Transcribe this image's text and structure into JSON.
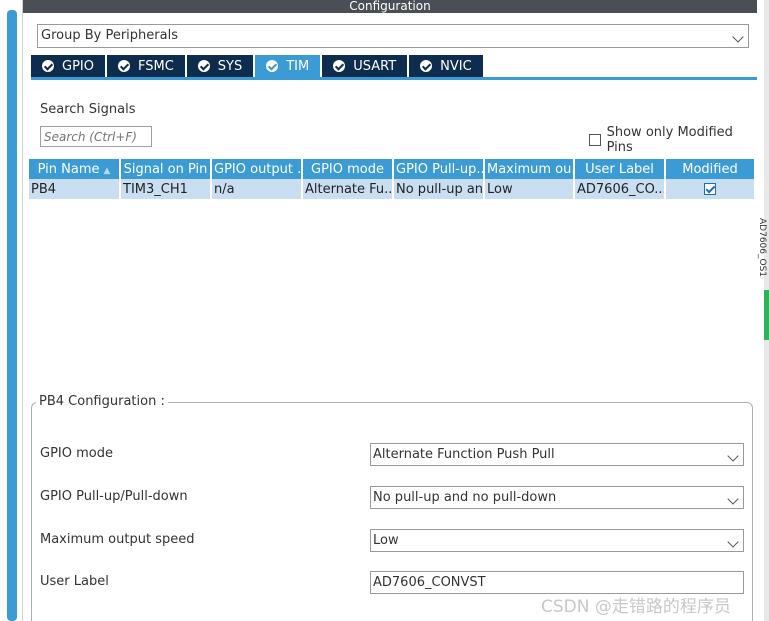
{
  "header": {
    "title": "Configuration"
  },
  "group_select": {
    "value": "Group By Peripherals"
  },
  "tabs": [
    {
      "label": "GPIO",
      "active": false
    },
    {
      "label": "FSMC",
      "active": false
    },
    {
      "label": "SYS",
      "active": false
    },
    {
      "label": "TIM",
      "active": true
    },
    {
      "label": "USART",
      "active": false
    },
    {
      "label": "NVIC",
      "active": false
    }
  ],
  "search": {
    "label": "Search Signals",
    "placeholder": "Search (Ctrl+F)"
  },
  "modified_toggle": {
    "label": "Show only Modified Pins",
    "checked": false
  },
  "table": {
    "columns": [
      "Pin Name",
      "Signal on Pin",
      "GPIO output ...",
      "GPIO mode",
      "GPIO Pull-up...",
      "Maximum ou...",
      "User Label",
      "Modified"
    ],
    "rows": [
      {
        "pin": "PB4",
        "signal": "TIM3_CH1",
        "output": "n/a",
        "mode": "Alternate Fu...",
        "pull": "No pull-up an...",
        "speed": "Low",
        "label": "AD7606_CO...",
        "modified": true
      }
    ]
  },
  "config": {
    "title": "PB4 Configuration :",
    "fields": [
      {
        "label": "GPIO mode",
        "value": "Alternate Function Push Pull"
      },
      {
        "label": "GPIO Pull-up/Pull-down",
        "value": "No pull-up and no pull-down"
      },
      {
        "label": "Maximum output speed",
        "value": "Low"
      },
      {
        "label": "User Label",
        "value": "AD7606_CONVST"
      }
    ]
  },
  "side_text": "AD7606_OS1",
  "watermark": "CSDN @走错路的程序员",
  "colors": {
    "accent": "#3b9bd4",
    "tab_dark": "#0e2d4e",
    "header": "#4a4f55",
    "row_selected": "#c9dff1"
  }
}
